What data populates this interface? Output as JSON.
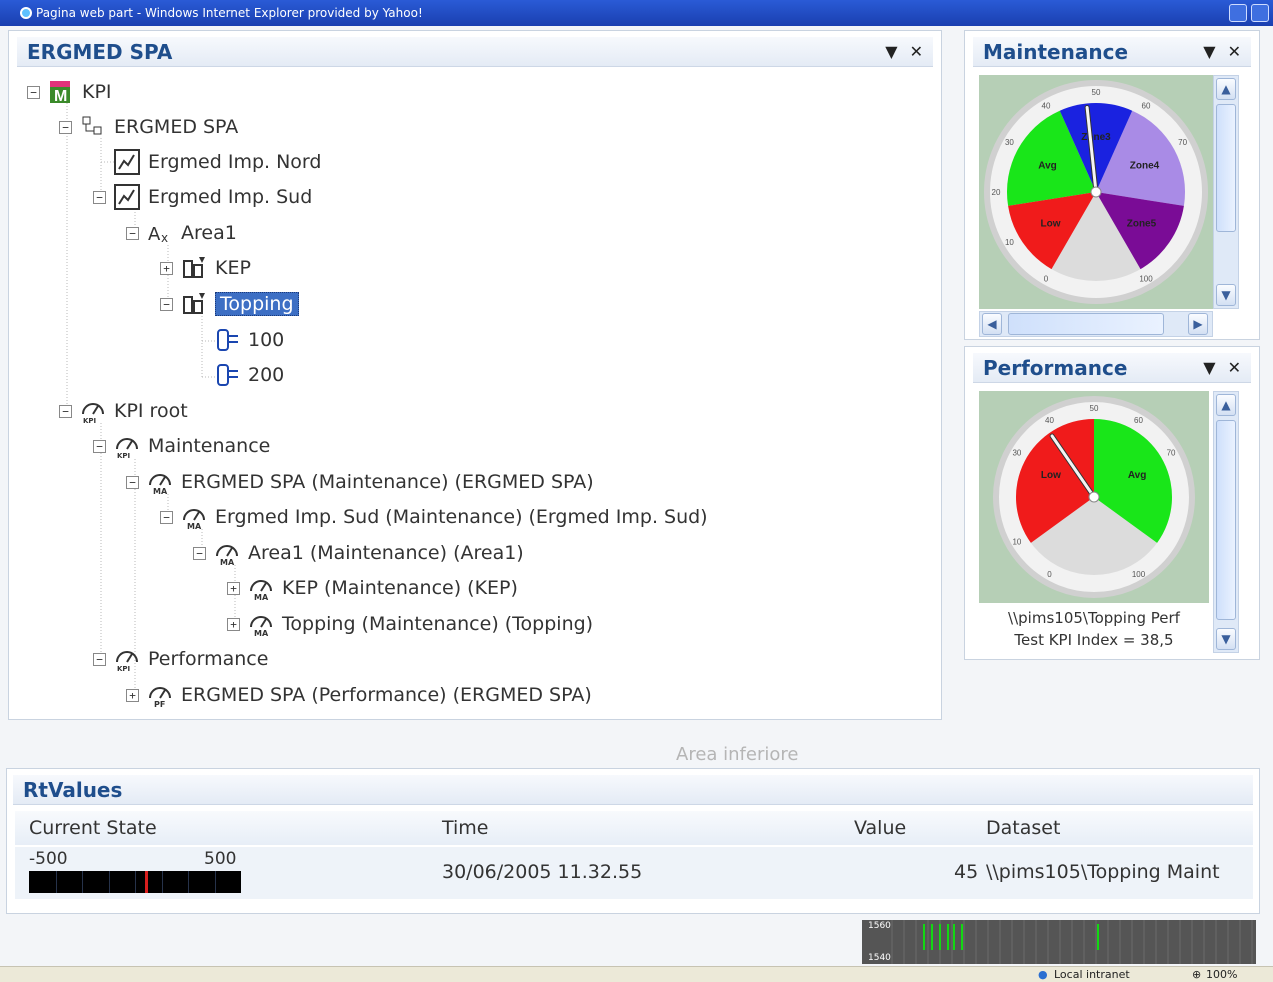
{
  "window": {
    "title": "Pagina web part - Windows Internet Explorer provided by Yahoo!"
  },
  "tree_panel": {
    "title": "ERGMED SPA",
    "menu_icon": "dropdown-arrow-icon",
    "close_icon": "close-icon",
    "nodes": [
      {
        "label": "KPI",
        "icon": "kpi-cube-icon",
        "expander": "−"
      },
      {
        "label": "ERGMED SPA",
        "icon": "org-icon",
        "expander": "−"
      },
      {
        "label": "Ergmed Imp. Nord",
        "icon": "plant-icon",
        "expander": ""
      },
      {
        "label": "Ergmed Imp. Sud",
        "icon": "plant-icon",
        "expander": "−"
      },
      {
        "label": "Area1",
        "icon": "area-icon",
        "expander": "−"
      },
      {
        "label": "KEP",
        "icon": "unit-icon",
        "expander": "+"
      },
      {
        "label": "Topping",
        "icon": "unit-icon",
        "expander": "−"
      },
      {
        "label": "100",
        "icon": "tag-icon",
        "expander": ""
      },
      {
        "label": "200",
        "icon": "tag-icon",
        "expander": ""
      },
      {
        "label": "KPI root",
        "icon": "kpi-gauge-icon",
        "expander": "−"
      },
      {
        "label": "Maintenance",
        "icon": "kpi-gauge-icon",
        "expander": "−"
      },
      {
        "label": "ERGMED SPA (Maintenance) (ERGMED SPA)",
        "icon": "ma-gauge-icon",
        "expander": "−"
      },
      {
        "label": "Ergmed Imp. Sud (Maintenance) (Ergmed Imp. Sud)",
        "icon": "ma-gauge-icon",
        "expander": "−"
      },
      {
        "label": "Area1 (Maintenance) (Area1)",
        "icon": "ma-gauge-icon",
        "expander": "−"
      },
      {
        "label": "KEP (Maintenance) (KEP)",
        "icon": "ma-gauge-icon",
        "expander": "+"
      },
      {
        "label": "Topping (Maintenance) (Topping)",
        "icon": "ma-gauge-icon",
        "expander": "+"
      },
      {
        "label": "Performance",
        "icon": "kpi-gauge-icon",
        "expander": "−"
      },
      {
        "label": "ERGMED SPA (Performance) (ERGMED SPA)",
        "icon": "pf-gauge-icon",
        "expander": "+"
      }
    ],
    "selected": "Topping"
  },
  "maintenance_panel": {
    "title": "Maintenance",
    "gauge": {
      "zones": [
        "Avg",
        "Low",
        "Zone5",
        "Zone4",
        "Zone3"
      ],
      "scale_labels": [
        "50",
        "40",
        "60",
        "30",
        "70",
        "20",
        "10",
        "0",
        "100"
      ],
      "needle_value": 48,
      "colors": {
        "avg": "#19e619",
        "low": "#f01b1b",
        "zone5": "#7a0c96",
        "zone4": "#a98be6",
        "zone3": "#1a22e0"
      }
    }
  },
  "performance_panel": {
    "title": "Performance",
    "gauge": {
      "zones": [
        "Low",
        "Avg"
      ],
      "scale_labels": [
        "50",
        "40",
        "60",
        "30",
        "70",
        "10",
        "0",
        "100"
      ],
      "needle_value": 38.5,
      "colors": {
        "low": "#f01b1b",
        "avg": "#19e619"
      }
    },
    "caption_line1": "\\\\pims105\\Topping Perf",
    "caption_line2": "Test KPI Index = 38,5"
  },
  "area_label": "Area inferiore",
  "rtvalues": {
    "title": "RtValues",
    "columns": [
      "Current State",
      "Time",
      "Value",
      "Dataset"
    ],
    "row": {
      "range_min": "-500",
      "range_max": "500",
      "time": "30/06/2005 11.32.55",
      "value": "45",
      "dataset": "\\\\pims105\\Topping Maint"
    },
    "state_fraction": 0.545
  },
  "trend": {
    "y_top": "1560",
    "y_bottom": "1540"
  },
  "statusbar": {
    "zone": "Local intranet",
    "zoom": "100%"
  }
}
